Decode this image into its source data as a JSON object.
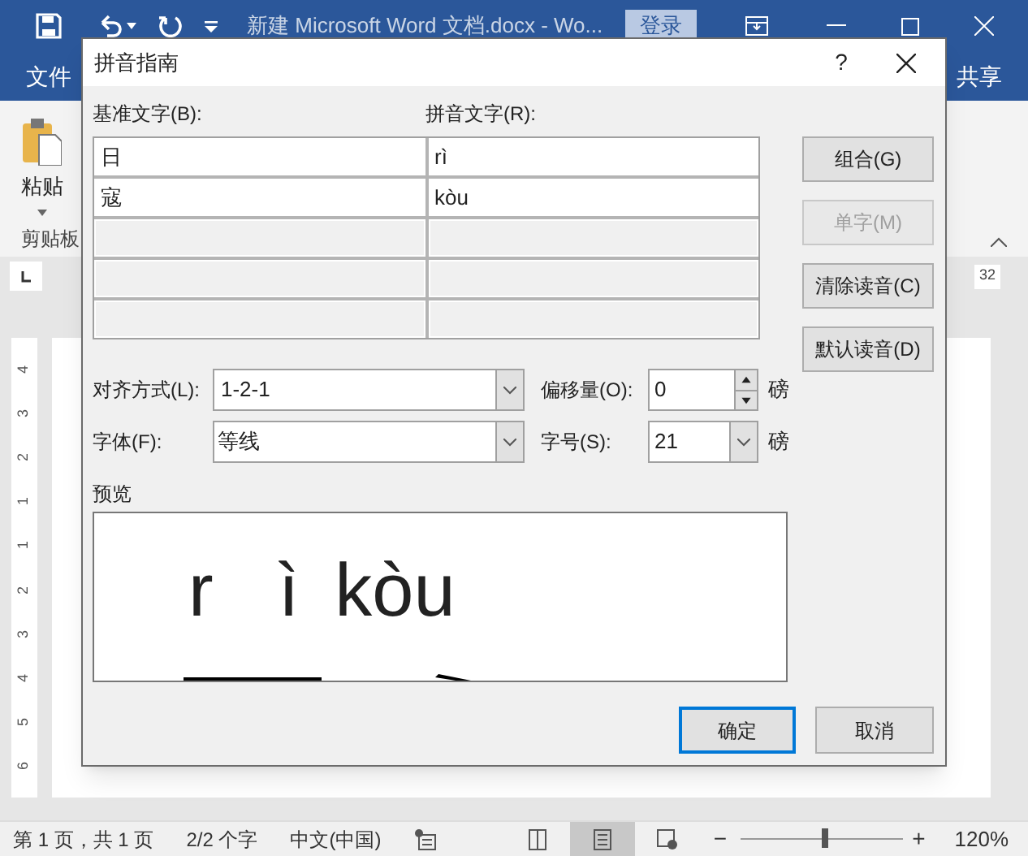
{
  "title_bar": {
    "title": "新建 Microsoft Word 文档.docx  -  Wo...",
    "sign_in": "登录"
  },
  "ribbon_tabs": [
    {
      "label": "文件"
    },
    {
      "label": "共享"
    }
  ],
  "ribbon": {
    "paste": "粘贴",
    "group": "剪贴板"
  },
  "ruler": {
    "mark": "32",
    "vertical": [
      "4",
      "3",
      "2",
      "1",
      "1",
      "2",
      "3",
      "4",
      "5",
      "6"
    ]
  },
  "dialog": {
    "title": "拼音指南",
    "help": "?",
    "base_label": "基准文字(B):",
    "ruby_label": "拼音文字(R):",
    "rows": [
      {
        "base": "日",
        "ruby": "rì",
        "disabled": false
      },
      {
        "base": "寇",
        "ruby": "kòu",
        "disabled": false
      },
      {
        "disabled": true
      },
      {
        "disabled": true
      },
      {
        "disabled": true
      }
    ],
    "side_buttons": [
      {
        "label": "组合(G)",
        "disabled": false
      },
      {
        "label": "单字(M)",
        "disabled": true
      },
      {
        "label": "清除读音(C)",
        "disabled": false
      },
      {
        "label": "默认读音(D)",
        "disabled": false
      }
    ],
    "alignment": {
      "label": "对齐方式(L):",
      "value": "1-2-1"
    },
    "offset": {
      "label": "偏移量(O):",
      "value": "0",
      "unit": "磅"
    },
    "font": {
      "label": "字体(F):",
      "value": "等线"
    },
    "size": {
      "label": "字号(S):",
      "value": "21",
      "unit": "磅"
    },
    "preview": {
      "label": "预览",
      "ruby": [
        {
          "text": "r"
        },
        {
          "text": "ì"
        },
        {
          "text": "kòu"
        }
      ]
    },
    "ok": "确定",
    "cancel": "取消"
  },
  "status_bar": {
    "page": "第 1 页，共 1 页",
    "words": "2/2 个字",
    "language": "中文(中国)",
    "views": [
      {
        "selected": false
      },
      {
        "selected": true
      },
      {
        "selected": false
      }
    ],
    "zoom": {
      "minus": "−",
      "plus": "+",
      "level": 0.52,
      "value": "120%"
    }
  }
}
